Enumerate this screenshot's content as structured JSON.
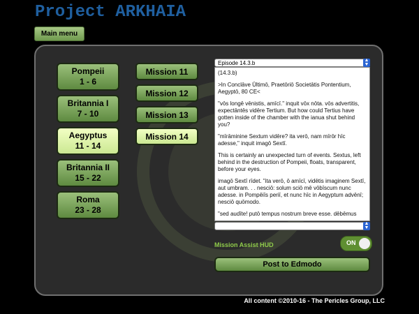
{
  "title": "Project ARKHAIA",
  "main_menu_label": "Main menu",
  "regions": [
    {
      "name": "Pompeii",
      "range": "1 - 6",
      "active": false
    },
    {
      "name": "Britannia I",
      "range": "7 - 10",
      "active": false
    },
    {
      "name": "Aegyptus",
      "range": "11 - 14",
      "active": true
    },
    {
      "name": "Britannia II",
      "range": "15 - 22",
      "active": false
    },
    {
      "name": "Roma",
      "range": "23 - 28",
      "active": false
    }
  ],
  "missions": [
    {
      "label": "Mission 11",
      "active": false
    },
    {
      "label": "Mission 12",
      "active": false
    },
    {
      "label": "Mission 13",
      "active": false
    },
    {
      "label": "Mission 14",
      "active": true
    }
  ],
  "episode_select": "Episode 14.3.b",
  "second_select": "",
  "text_paragraphs": [
    "(14.3.b)",
    ">In Conclāve Ūltimō, Praetōriō Societātis Pontentium, Aegyptō, 80 CE<",
    "\"vōs longē vēnistis, amīcī.\" inquit vōx nōta. vōs advertitis, expectāntēs vidēre Tertium. But how could Tertius have gotten inside of the chamber with the ianua shut behind you?",
    "\"mīrāminine Sextum vidēre? ita verō, nam mīrōr hīc adesse,\" inquit imagō Sextī.",
    "This is certainly an unexpected turn of events. Sextus, left behind in the destruction of Pompeii, floats, transparent, before your eyes.",
    "imagō Sextī rīdet. \"ita verō, ō amīcī, vidētis imaginem Sextī, aut umbram. . . nesciō: solum sciō mē vōbīscum nunc adesse. in Pompēiīs periī, et nunc hīc in Aegyptum advēnī; nesciō quōmodo.",
    "\"sed audīte! putō tempus nostrum breve esse. dēbēmus"
  ],
  "hud_label": "Mission Assist HUD",
  "toggle_label": "ON",
  "post_label": "Post to Edmodo",
  "footer": "All content ©2010-16 - The Pericles Group, LLC",
  "colors": {
    "accent_green": "#8fcb4a",
    "title_blue": "#1f5f9f",
    "select_blue": "#2a64d2"
  }
}
